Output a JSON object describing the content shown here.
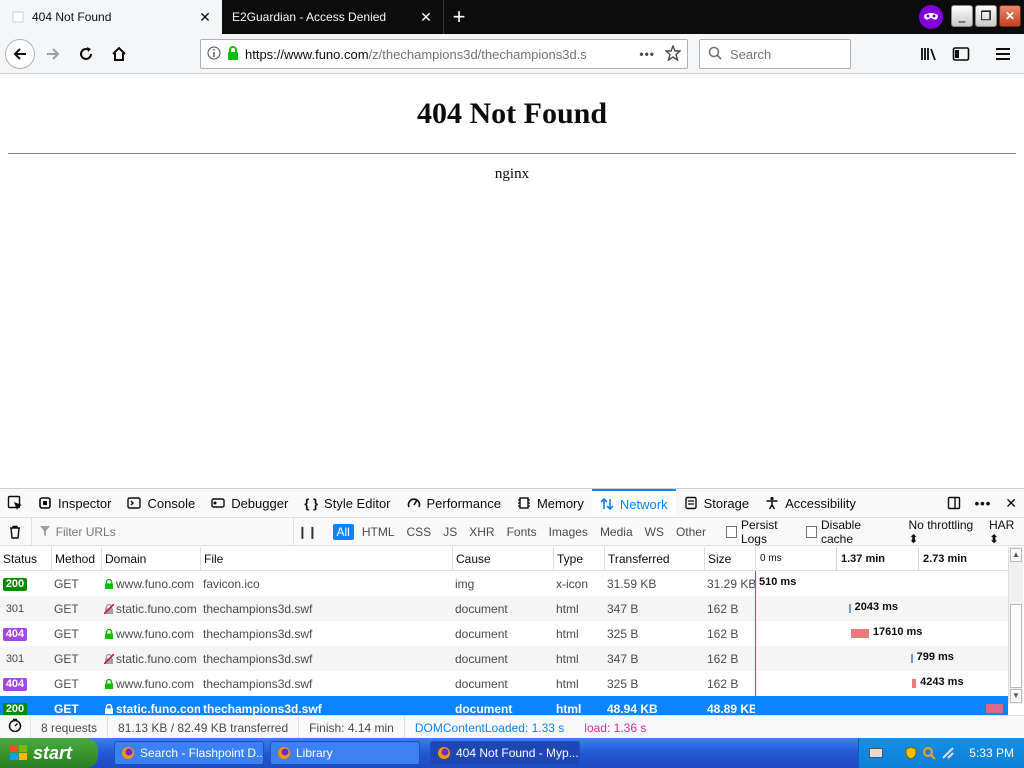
{
  "browser": {
    "tabs": [
      {
        "title": "404 Not Found",
        "active": true
      },
      {
        "title": "E2Guardian - Access Denied",
        "active": false
      }
    ],
    "url_host": "https://www.funo.com",
    "url_path": "/z/thechampions3d/thechampions3d.s",
    "search_placeholder": "Search"
  },
  "page": {
    "heading": "404 Not Found",
    "server": "nginx"
  },
  "devtools": {
    "tabs": [
      "Inspector",
      "Console",
      "Debugger",
      "Style Editor",
      "Performance",
      "Memory",
      "Network",
      "Storage",
      "Accessibility"
    ],
    "selected_tab": "Network",
    "filter_placeholder": "Filter URLs",
    "pause_label": "❙❙",
    "type_filters": [
      "All",
      "HTML",
      "CSS",
      "JS",
      "XHR",
      "Fonts",
      "Images",
      "Media",
      "WS",
      "Other"
    ],
    "persist_logs": "Persist Logs",
    "disable_cache": "Disable cache",
    "throttling": "No throttling",
    "har": "HAR",
    "columns": [
      "Status",
      "Method",
      "Domain",
      "File",
      "Cause",
      "Type",
      "Transferred",
      "Size"
    ],
    "waterfall_ticks": [
      "0 ms",
      "1.37 min",
      "2.73 min"
    ],
    "requests": [
      {
        "status": "200",
        "method": "GET",
        "domain": "www.funo.com",
        "secure": true,
        "file": "favicon.ico",
        "cause": "img",
        "type": "x-icon",
        "transferred": "31.59 KB",
        "size": "31.29 KB",
        "time": "510 ms",
        "wf_start_pct": 0.0,
        "wf_width_pct": 0.0
      },
      {
        "status": "301",
        "method": "GET",
        "domain": "static.funo.com",
        "secure": false,
        "file": "thechampions3d.swf",
        "cause": "document",
        "type": "html",
        "transferred": "347 B",
        "size": "162 B",
        "time": "2043 ms",
        "wf_start_pct": 37.0,
        "wf_width_pct": 0.8
      },
      {
        "status": "404",
        "method": "GET",
        "domain": "www.funo.com",
        "secure": true,
        "file": "thechampions3d.swf",
        "cause": "document",
        "type": "html",
        "transferred": "325 B",
        "size": "162 B",
        "time": "17610 ms",
        "wf_start_pct": 38.0,
        "wf_width_pct": 7.0
      },
      {
        "status": "301",
        "method": "GET",
        "domain": "static.funo.com",
        "secure": false,
        "file": "thechampions3d.swf",
        "cause": "document",
        "type": "html",
        "transferred": "347 B",
        "size": "162 B",
        "time": "799 ms",
        "wf_start_pct": 61.5,
        "wf_width_pct": 0.6
      },
      {
        "status": "404",
        "method": "GET",
        "domain": "www.funo.com",
        "secure": true,
        "file": "thechampions3d.swf",
        "cause": "document",
        "type": "html",
        "transferred": "325 B",
        "size": "162 B",
        "time": "4243 ms",
        "wf_start_pct": 61.9,
        "wf_width_pct": 1.8
      },
      {
        "status": "200",
        "method": "GET",
        "domain": "static.funo.com",
        "secure": true,
        "file": "thechampions3d.swf",
        "cause": "document",
        "type": "html",
        "transferred": "48.94 KB",
        "size": "48.89 KB",
        "time": "",
        "wf_start_pct": 91.5,
        "wf_width_pct": 6.5,
        "selected": true
      }
    ],
    "status": {
      "requests": "8 requests",
      "transferred": "81.13 KB / 82.49 KB transferred",
      "finish": "Finish: 4.14 min",
      "dcl": "DOMContentLoaded: 1.33 s",
      "load": "load: 1.36 s"
    }
  },
  "taskbar": {
    "start": "start",
    "tasks": [
      "Search - Flashpoint D...",
      "Library",
      "404 Not Found - Myp..."
    ],
    "clock": "5:33 PM"
  },
  "colors": {
    "accent": "#0a84ff",
    "status_ok": "#058b00",
    "status_404": "#a347e5",
    "load_line": "#e0279b"
  }
}
